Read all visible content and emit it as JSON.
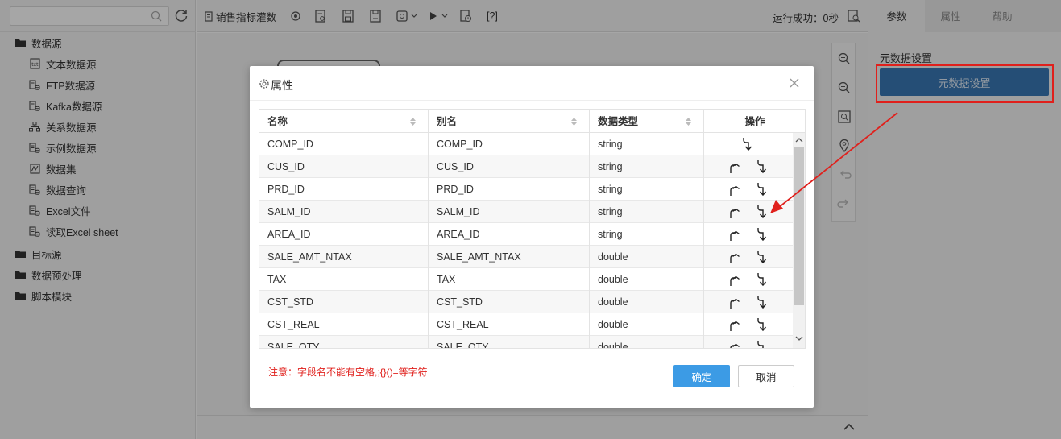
{
  "sidebar": {
    "search_placeholder": "",
    "tree": [
      {
        "label": "数据源",
        "icon": "folder-icon",
        "level": 0
      },
      {
        "label": "文本数据源",
        "icon": "text-file-icon",
        "level": 1
      },
      {
        "label": "FTP数据源",
        "icon": "database-icon",
        "level": 1
      },
      {
        "label": "Kafka数据源",
        "icon": "database-icon",
        "level": 1
      },
      {
        "label": "关系数据源",
        "icon": "relation-icon",
        "level": 1
      },
      {
        "label": "示例数据源",
        "icon": "database-icon",
        "level": 1
      },
      {
        "label": "数据集",
        "icon": "dataset-icon",
        "level": 1
      },
      {
        "label": "数据查询",
        "icon": "database-icon",
        "level": 1
      },
      {
        "label": "Excel文件",
        "icon": "database-icon",
        "level": 1
      },
      {
        "label": "读取Excel sheet",
        "icon": "database-icon",
        "level": 1
      },
      {
        "label": "目标源",
        "icon": "folder-icon",
        "level": 0
      },
      {
        "label": "数据预处理",
        "icon": "folder-icon",
        "level": 0
      },
      {
        "label": "脚本模块",
        "icon": "folder-icon",
        "level": 0
      }
    ]
  },
  "toolbar": {
    "flow_name": "销售指标灌数",
    "help_label": "[?]",
    "run_status": "运行成功：0秒"
  },
  "right_panel": {
    "tabs": [
      "参数",
      "属性",
      "帮助"
    ],
    "meta_label": "元数据设置",
    "meta_button": "元数据设置"
  },
  "modal": {
    "title": "属性",
    "columns": [
      "名称",
      "别名",
      "数据类型",
      "操作"
    ],
    "rows": [
      {
        "name": "COMP_ID",
        "alias": "COMP_ID",
        "type": "string",
        "up": false,
        "down": true
      },
      {
        "name": "CUS_ID",
        "alias": "CUS_ID",
        "type": "string",
        "up": true,
        "down": true
      },
      {
        "name": "PRD_ID",
        "alias": "PRD_ID",
        "type": "string",
        "up": true,
        "down": true
      },
      {
        "name": "SALM_ID",
        "alias": "SALM_ID",
        "type": "string",
        "up": true,
        "down": true
      },
      {
        "name": "AREA_ID",
        "alias": "AREA_ID",
        "type": "string",
        "up": true,
        "down": true
      },
      {
        "name": "SALE_AMT_NTAX",
        "alias": "SALE_AMT_NTAX",
        "type": "double",
        "up": true,
        "down": true
      },
      {
        "name": "TAX",
        "alias": "TAX",
        "type": "double",
        "up": true,
        "down": true
      },
      {
        "name": "CST_STD",
        "alias": "CST_STD",
        "type": "double",
        "up": true,
        "down": true
      },
      {
        "name": "CST_REAL",
        "alias": "CST_REAL",
        "type": "double",
        "up": true,
        "down": true
      },
      {
        "name": "SALE_QTY",
        "alias": "SALE_QTY",
        "type": "double",
        "up": true,
        "down": true
      }
    ],
    "note": "注意：字段名不能有空格,;{}()=等字符",
    "ok_label": "确定",
    "cancel_label": "取消"
  },
  "colors": {
    "accent": "#3c9be5",
    "annotation": "#e0201c",
    "meta_button": "#3a78b5"
  }
}
